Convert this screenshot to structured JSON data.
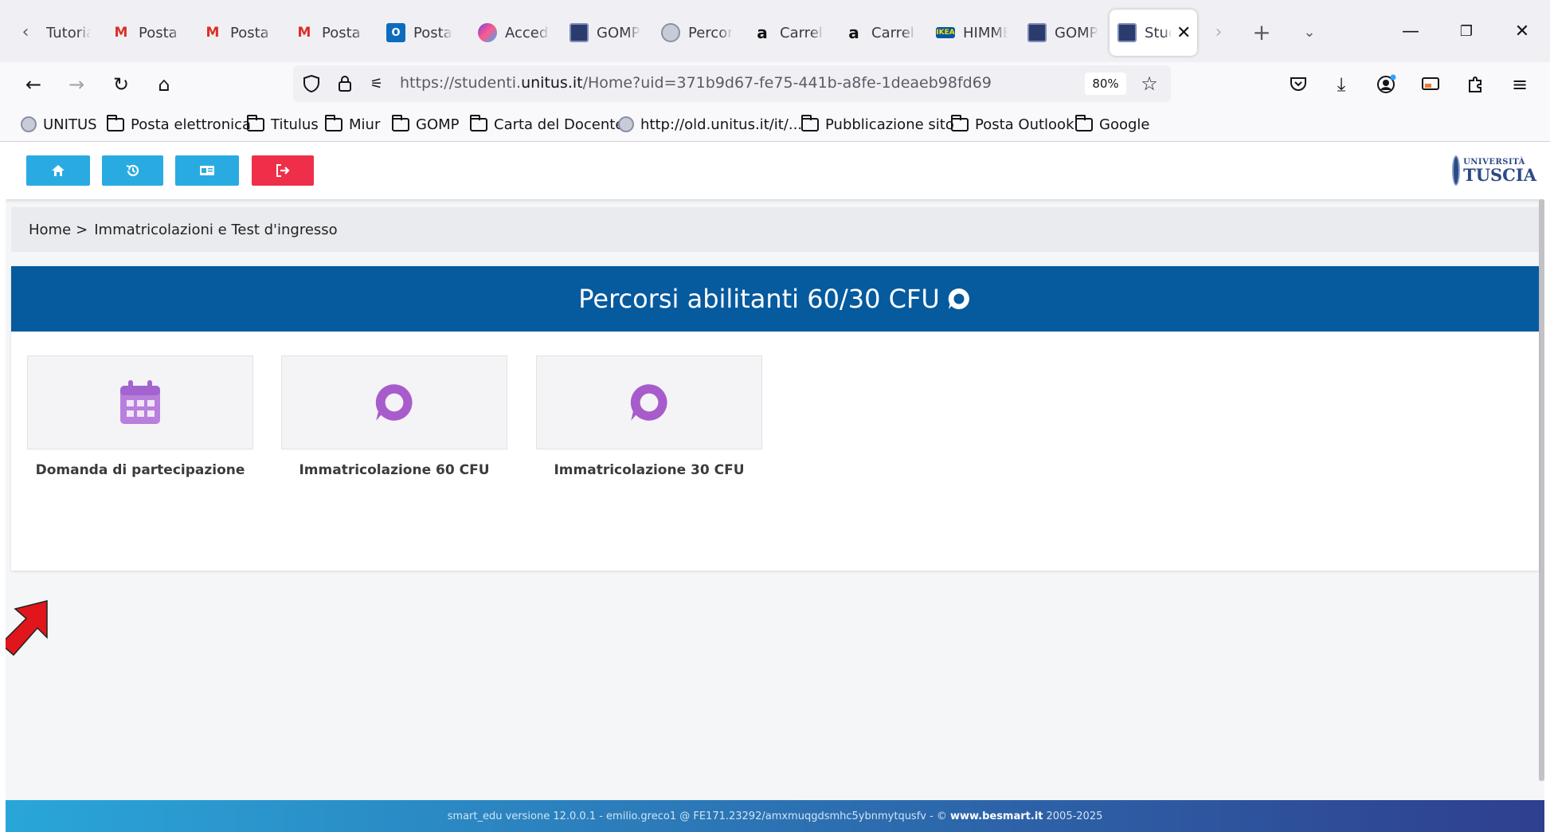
{
  "browser": {
    "tabs": [
      {
        "label": "Tutorial",
        "favicon": "none"
      },
      {
        "label": "Posta in arrivo",
        "favicon": "gmail-icon"
      },
      {
        "label": "Posta in arrivo",
        "favicon": "gmail-icon"
      },
      {
        "label": "Posta in arrivo",
        "favicon": "gmail-icon"
      },
      {
        "label": "Posta",
        "favicon": "outlook-icon"
      },
      {
        "label": "Accedi",
        "favicon": "copilot-icon"
      },
      {
        "label": "GOMP",
        "favicon": "gomp-icon"
      },
      {
        "label": "Percorsi",
        "favicon": "unitus-seal-icon"
      },
      {
        "label": "Carrello",
        "favicon": "amazon-icon"
      },
      {
        "label": "Carrello",
        "favicon": "amazon-icon"
      },
      {
        "label": "HIMMELSK",
        "favicon": "ikea-icon"
      },
      {
        "label": "GOMP",
        "favicon": "gomp-icon"
      },
      {
        "label": "Studenti",
        "favicon": "gomp-icon",
        "active": true
      }
    ],
    "url": {
      "prefix": "https://studenti.",
      "host": "unitus.it",
      "path": "/Home?uid=371b9d67-fe75-441b-a8fe-1deaeb98fd69"
    },
    "zoom": "80%",
    "bookmarks": [
      {
        "label": "UNITUS",
        "icon": "seal"
      },
      {
        "label": "Posta elettronica",
        "icon": "folder"
      },
      {
        "label": "Titulus",
        "icon": "folder"
      },
      {
        "label": "Miur",
        "icon": "folder"
      },
      {
        "label": "GOMP",
        "icon": "folder"
      },
      {
        "label": "Carta del Docente",
        "icon": "folder"
      },
      {
        "label": "http://old.unitus.it/it/...",
        "icon": "seal"
      },
      {
        "label": "Pubblicazione sito",
        "icon": "folder"
      },
      {
        "label": "Posta Outlook",
        "icon": "folder"
      },
      {
        "label": "Google",
        "icon": "folder"
      }
    ]
  },
  "app": {
    "toolbar": {
      "buttons": [
        "home-icon",
        "history-icon",
        "id-card-icon",
        "logout-icon"
      ]
    },
    "logo": {
      "line1": "UNIVERSITÀ",
      "line2": "TUSCIA"
    },
    "breadcrumb": {
      "home": "Home",
      "separator": ">",
      "current": "Immatricolazioni e Test d'ingresso"
    },
    "panel": {
      "title": "Percorsi abilitanti 60/30 CFU",
      "cards": [
        {
          "label": "Domanda di partecipazione",
          "icon": "calendar-icon"
        },
        {
          "label": "Immatricolazione 60 CFU",
          "icon": "chat-bubble-icon"
        },
        {
          "label": "Immatricolazione 30 CFU",
          "icon": "chat-bubble-icon"
        }
      ]
    },
    "footer": {
      "text_before": "smart_edu versione 12.0.0.1 - emilio.greco1 @ FE171.23292/amxmuqgdsmhc5ybnmytqusfv - ©",
      "link": "www.besmart.it",
      "text_after": "2005-2025"
    }
  },
  "colors": {
    "header_blue": "#065a9e",
    "button_blue": "#29abe2",
    "button_red": "#ef2f4a",
    "icon_purple": "#a85ccc",
    "calendar_purple": "#b87fdc",
    "annotation_red": "#e0161c"
  }
}
